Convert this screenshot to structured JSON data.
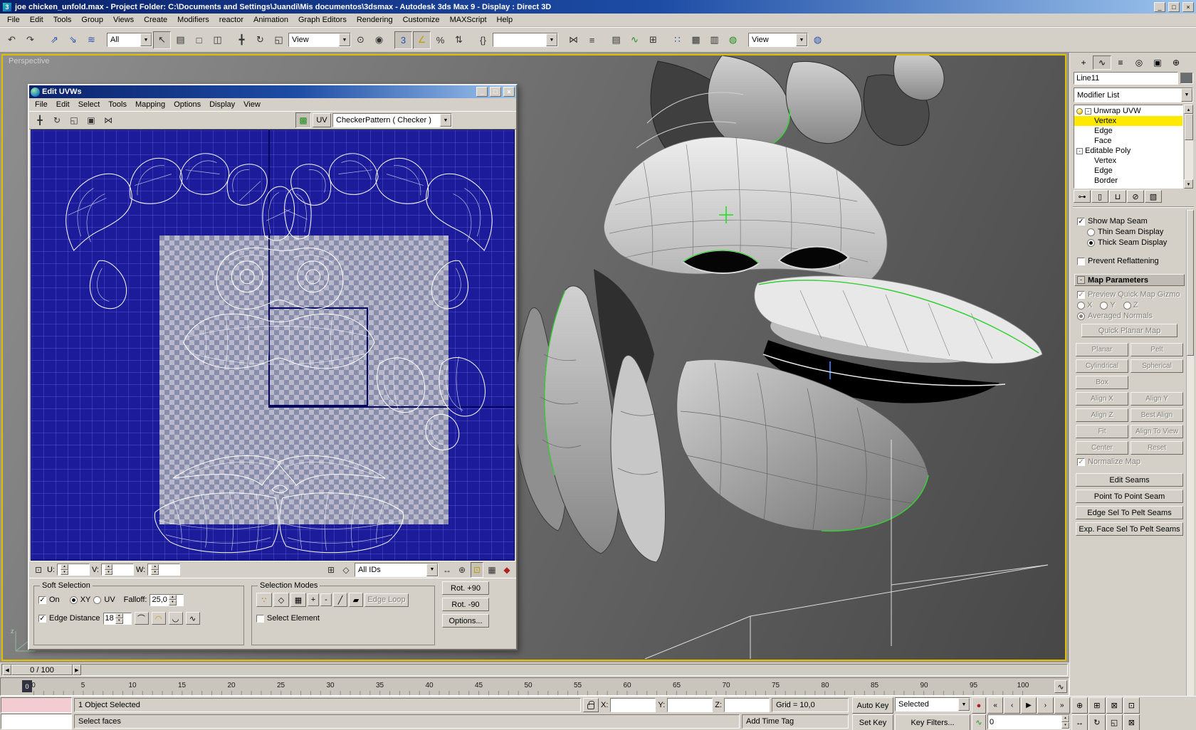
{
  "titlebar": {
    "title": "joe chicken_unfold.max    - Project Folder: C:\\Documents and Settings\\Juandi\\Mis documentos\\3dsmax    - Autodesk 3ds Max 9     - Display : Direct 3D"
  },
  "menubar": {
    "items": [
      "File",
      "Edit",
      "Tools",
      "Group",
      "Views",
      "Create",
      "Modifiers",
      "reactor",
      "Animation",
      "Graph Editors",
      "Rendering",
      "Customize",
      "MAXScript",
      "Help"
    ]
  },
  "toolbar": {
    "selection_filter": "All",
    "ref_coord": "View",
    "named_sets": "",
    "view_dropdown": "View"
  },
  "viewport": {
    "label": "Perspective"
  },
  "uvw": {
    "title": "Edit UVWs",
    "menus": [
      "File",
      "Edit",
      "Select",
      "Tools",
      "Mapping",
      "Options",
      "Display",
      "View"
    ],
    "uv_button": "UV",
    "texture": "CheckerPattern  ( Checker )",
    "u": "U:",
    "v": "V:",
    "w": "W:",
    "ids": "All IDs",
    "soft": {
      "title": "Soft Selection",
      "on": "On",
      "xy": "XY",
      "uv": "UV",
      "falloff": "Falloff:",
      "falloff_val": "25,0",
      "edge_dist": "Edge Distance",
      "edge_val": "18"
    },
    "modes": {
      "title": "Selection Modes",
      "plus": "+",
      "minus": "-",
      "select_element": "Select Element",
      "edge_loop": "Edge Loop"
    },
    "rot_plus": "Rot. +90",
    "rot_minus": "Rot. -90",
    "options": "Options..."
  },
  "panel": {
    "object_name": "Line11",
    "modifier_list": "Modifier List",
    "stack": [
      {
        "label": "Unwrap UVW",
        "kind": "mod",
        "bulb": true
      },
      {
        "label": "Vertex",
        "kind": "sub",
        "selected": true
      },
      {
        "label": "Edge",
        "kind": "sub"
      },
      {
        "label": "Face",
        "kind": "sub"
      },
      {
        "label": "Editable Poly",
        "kind": "mod"
      },
      {
        "label": "Vertex",
        "kind": "sub"
      },
      {
        "label": "Edge",
        "kind": "sub"
      },
      {
        "label": "Border",
        "kind": "sub"
      }
    ],
    "show_map_seam": "Show Map Seam",
    "thin_seam": "Thin Seam Display",
    "thick_seam": "Thick Seam Display",
    "prevent_reflattening": "Prevent Reflattening",
    "map_parameters": "Map Parameters",
    "preview_gizmo": "Preview Quick Map Gizmo",
    "axis": [
      "X",
      "Y",
      "Z"
    ],
    "averaged_normals": "Averaged Normals",
    "quick_planar": "Quick Planar Map",
    "map_buttons": [
      "Planar",
      "Pelt",
      "Cylindrical",
      "Spherical",
      "Box",
      null,
      "Align X",
      "Align Y",
      "Align Z",
      "Best Align",
      "Fit",
      "Align To View",
      "Center",
      "Reset"
    ],
    "normalize_map": "Normalize Map",
    "seam_buttons": [
      "Edit Seams",
      "Point To Point Seam",
      "Edge Sel To Pelt Seams",
      "Exp. Face Sel To Pelt Seams"
    ]
  },
  "timeline": {
    "slider": "0 / 100",
    "current": "0",
    "ticks": [
      0,
      5,
      10,
      15,
      20,
      25,
      30,
      35,
      40,
      45,
      50,
      55,
      60,
      65,
      70,
      75,
      80,
      85,
      90,
      95,
      100
    ]
  },
  "status": {
    "object_selected": "1 Object Selected",
    "prompt": "Select faces",
    "x": "X:",
    "y": "Y:",
    "z": "Z:",
    "grid": "Grid = 10,0",
    "add_time_tag": "Add Time Tag",
    "auto_key": "Auto Key",
    "set_key": "Set Key",
    "selected_mode": "Selected",
    "key_filters": "Key Filters...",
    "frame": "0"
  },
  "icons": {
    "undo": "↶",
    "redo": "↷",
    "select_link": "⇗",
    "unlink": "⇘",
    "bind_spacewarp": "≋",
    "select_object": "↖",
    "select_by_name": "▤",
    "rect_region": "□",
    "window_crossing": "◫",
    "move": "╋",
    "rotate": "↻",
    "scale": "◱",
    "pivot_center": "⊙",
    "manipulate": "◉",
    "snap_3d": "3",
    "angle_snap": "∠",
    "percent_snap": "%",
    "spinner_snap": "⇅",
    "edit_named_sets": "{}",
    "mirror": "⋈",
    "align": "≡",
    "layer_manager": "▤",
    "curve_editor": "∿",
    "schematic_view": "⊞",
    "material_editor": "∷",
    "render_setup": "▦",
    "render_last": "▥",
    "quick_render": "◍",
    "min_btn": "_",
    "max_btn": "□",
    "close_btn": "×",
    "uvw_move": "╋",
    "uvw_rotate": "↻",
    "uvw_scale": "◱",
    "uvw_freeform": "▣",
    "uvw_mirror": "⋈",
    "uvw_show_map": "▩",
    "mode_vertex": "∵",
    "mode_edge": "◇",
    "mode_face": "▦",
    "brush": "╱",
    "brush2": "▰",
    "curve1": "⌒",
    "curve2": "◠",
    "curve3": "◡",
    "curve4": "∿",
    "uv_abs": "⊡",
    "uv_misc1": "⊞",
    "uv_misc2": "◇",
    "uv_pan": "↔",
    "uv_zoom": "⊕",
    "uv_zoom_region": "⊡",
    "uv_snap": "▦",
    "uv_filter": "◆",
    "go_start": "«",
    "prev_frame": "‹",
    "play": "▶",
    "next_frame": "›",
    "go_end": "»",
    "key_mode": "●",
    "mini_curve": "∿",
    "nav_zoom": "⊕",
    "nav_zoom_all": "⊞",
    "nav_zoom_ext": "⊠",
    "nav_zoom_region": "⊡",
    "nav_pan": "↔",
    "nav_orbit": "↻",
    "nav_maximize": "◱",
    "ts_left": "◀",
    "ts_right": "▶",
    "pin_stack": "⊶",
    "show_end_result": "▯",
    "make_unique": "⊔",
    "remove_modifier": "⊘",
    "configure_sets": "▧",
    "tab_create": "+",
    "tab_modify": "∿",
    "tab_hierarchy": "≡",
    "tab_motion": "◎",
    "tab_display": "▣",
    "tab_utilities": "⊕",
    "dropdown_arrow": "▼",
    "spin_up": "▴",
    "spin_down": "▾",
    "expand": "⊟"
  }
}
